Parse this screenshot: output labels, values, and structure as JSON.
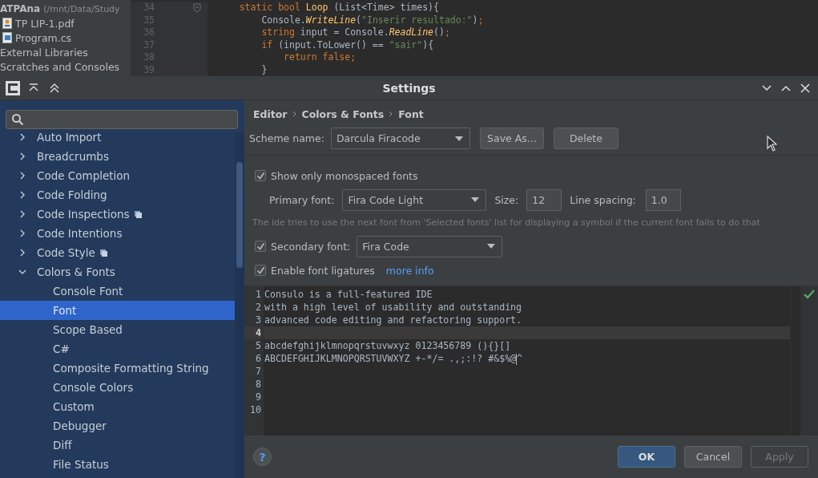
{
  "project_tree": {
    "root": {
      "name": "ATPAna",
      "path": "(/mnt/Data/Study"
    },
    "items": [
      {
        "label": "TP LIP-1.pdf",
        "kind": "pdf"
      },
      {
        "label": "Program.cs",
        "kind": "cs"
      },
      {
        "label": "External Libraries",
        "kind": "plain"
      },
      {
        "label": "Scratches and Consoles",
        "kind": "plain"
      }
    ]
  },
  "code_editor": {
    "lines": [
      {
        "number": "34",
        "fold": true,
        "tokens": [
          {
            "text": "    static bool ",
            "kind": "keyword"
          },
          {
            "text": "Loop ",
            "kind": "method"
          },
          {
            "text": "(List<Time> times){"
          }
        ]
      },
      {
        "number": "35",
        "tokens": [
          {
            "text": "        Console."
          },
          {
            "text": "WriteLine",
            "kind": "call"
          },
          {
            "text": "("
          },
          {
            "text": "\"Inserir resultado:\"",
            "kind": "string"
          },
          {
            "text": ")"
          },
          {
            "text": ";",
            "kind": "keyword"
          }
        ]
      },
      {
        "number": "36",
        "tokens": [
          {
            "text": "        string ",
            "kind": "keyword"
          },
          {
            "text": "input = Console."
          },
          {
            "text": "ReadLine",
            "kind": "call"
          },
          {
            "text": "()"
          },
          {
            "text": ";",
            "kind": "keyword"
          }
        ]
      },
      {
        "number": "37",
        "tokens": [
          {
            "text": "        if ",
            "kind": "keyword"
          },
          {
            "text": "(input.ToLower() == "
          },
          {
            "text": "\"sair\"",
            "kind": "string"
          },
          {
            "text": "){"
          }
        ]
      },
      {
        "number": "38",
        "tokens": [
          {
            "text": "            return false;",
            "kind": "keyword"
          }
        ]
      },
      {
        "number": "39",
        "tokens": [
          {
            "text": "        }"
          }
        ]
      }
    ]
  },
  "dialog": {
    "title": "Settings",
    "tree": [
      {
        "label": "Auto Import",
        "expanded": false,
        "selected": false,
        "badge": false
      },
      {
        "label": "Breadcrumbs",
        "expanded": false,
        "selected": false,
        "badge": false
      },
      {
        "label": "Code Completion",
        "expanded": false,
        "selected": false,
        "badge": false
      },
      {
        "label": "Code Folding",
        "expanded": false,
        "selected": false,
        "badge": false
      },
      {
        "label": "Code Inspections",
        "expanded": false,
        "selected": false,
        "badge": true
      },
      {
        "label": "Code Intentions",
        "expanded": false,
        "selected": false,
        "badge": false
      },
      {
        "label": "Code Style",
        "expanded": false,
        "selected": false,
        "badge": true
      },
      {
        "label": "Colors & Fonts",
        "expanded": true,
        "selected": false,
        "badge": false,
        "children": [
          {
            "label": "Console Font",
            "selected": false,
            "badge": false
          },
          {
            "label": "Font",
            "selected": true,
            "badge": false
          },
          {
            "label": "Scope Based",
            "selected": false,
            "badge": false
          },
          {
            "label": "C#",
            "selected": false,
            "badge": false
          },
          {
            "label": "Composite Formatting String",
            "selected": false,
            "badge": false
          },
          {
            "label": "Console Colors",
            "selected": false,
            "badge": false
          },
          {
            "label": "Custom",
            "selected": false,
            "badge": false
          },
          {
            "label": "Debugger",
            "selected": false,
            "badge": false
          },
          {
            "label": "Diff",
            "selected": false,
            "badge": false
          },
          {
            "label": "File Status",
            "selected": false,
            "badge": false
          }
        ]
      }
    ],
    "breadcrumb": [
      "Editor",
      "Colors & Fonts",
      "Font"
    ],
    "scheme": {
      "label": "Scheme name:",
      "value": "Darcula Firacode",
      "buttons": [
        "Save As...",
        "Delete"
      ]
    },
    "show_monospaced": {
      "label": "Show only monospaced fonts",
      "checked": true
    },
    "primary_font": {
      "label": "Primary font:",
      "value": "Fira Code Light"
    },
    "size": {
      "label": "Size:",
      "value": "12"
    },
    "line_spacing": {
      "label": "Line spacing:",
      "value": "1.0"
    },
    "hint": "The ide tries to use the next font from 'Selected fonts' list for displaying a symbol if the current font fails to do that",
    "secondary_font": {
      "label": "Secondary font:",
      "value": "Fira Code",
      "checked": true
    },
    "ligatures": {
      "label": "Enable font ligatures",
      "checked": true,
      "link": "more info"
    },
    "preview": [
      {
        "number": "1",
        "text": "Consulo is a full-featured IDE",
        "highlighted": false
      },
      {
        "number": "2",
        "text": "with a high level of usability and outstanding",
        "highlighted": false
      },
      {
        "number": "3",
        "text": "advanced code editing and refactoring support.",
        "highlighted": false
      },
      {
        "number": "4",
        "highlighted": true
      },
      {
        "number": "5",
        "text": "abcdefghijklmnopqrstuvwxyz 0123456789 (){}[]",
        "highlighted": false
      },
      {
        "number": "6",
        "text": "ABCDEFGHIJKLMNOPQRSTUVWXYZ +-*/= .,;:!? #&$%@",
        "after_caret": "^",
        "highlighted": false
      },
      {
        "number": "7",
        "highlighted": false
      },
      {
        "number": "8",
        "highlighted": false
      },
      {
        "number": "9",
        "highlighted": false
      },
      {
        "number": "10",
        "highlighted": false
      }
    ],
    "help_button": "?",
    "footer_buttons": [
      {
        "label": "OK",
        "kind": "default",
        "disabled": false
      },
      {
        "label": "Cancel",
        "kind": "normal",
        "disabled": false
      },
      {
        "label": "Apply",
        "kind": "normal",
        "disabled": true
      }
    ]
  }
}
